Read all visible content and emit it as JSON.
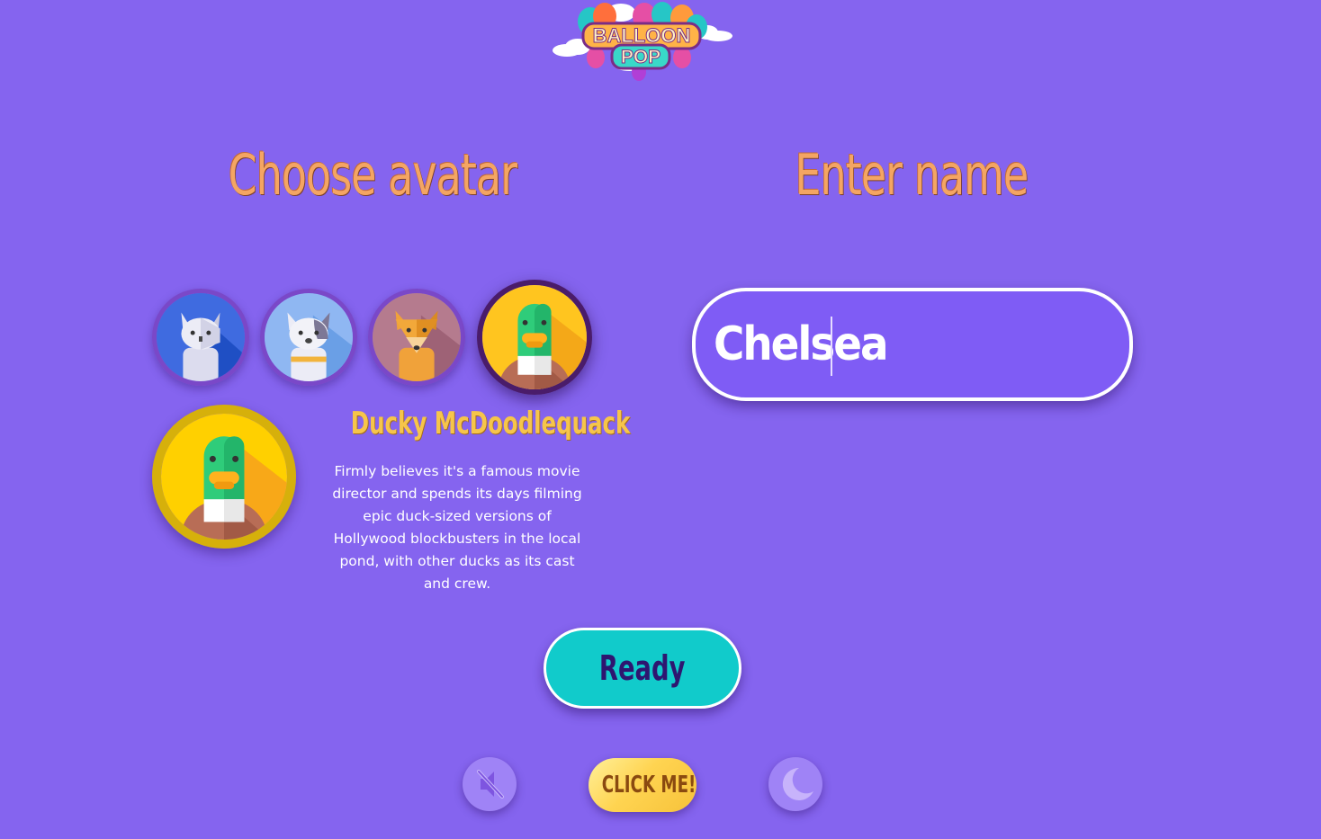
{
  "logo": {
    "line1": "BALLOON",
    "line2": "POP"
  },
  "avatar_section": {
    "heading": "Choose avatar",
    "options": [
      {
        "animal": "cat",
        "icon": "cat-avatar-icon",
        "selected": false
      },
      {
        "animal": "dog",
        "icon": "dog-avatar-icon",
        "selected": false
      },
      {
        "animal": "fox",
        "icon": "fox-avatar-icon",
        "selected": false
      },
      {
        "animal": "duck",
        "icon": "duck-avatar-icon",
        "selected": true
      }
    ],
    "selected_pet": {
      "name": "Ducky McDoodlequack",
      "description": "Firmly believes it's a famous movie director and spends its days filming epic duck-sized versions of Hollywood blockbusters in the local pond, with other ducks as its cast and crew."
    }
  },
  "name_section": {
    "heading": "Enter name",
    "input_value": "Chelsea"
  },
  "actions": {
    "ready_label": "Ready",
    "click_me_label": "CLICK ME!",
    "mute_icon": "muted-speaker-icon",
    "theme_icon": "moon-icon"
  },
  "colors": {
    "background": "#8564ef",
    "heading": "#f4a563",
    "pet_name": "#f6c54a",
    "ready_button": "#11cbcb",
    "click_button": "#ffd451"
  }
}
